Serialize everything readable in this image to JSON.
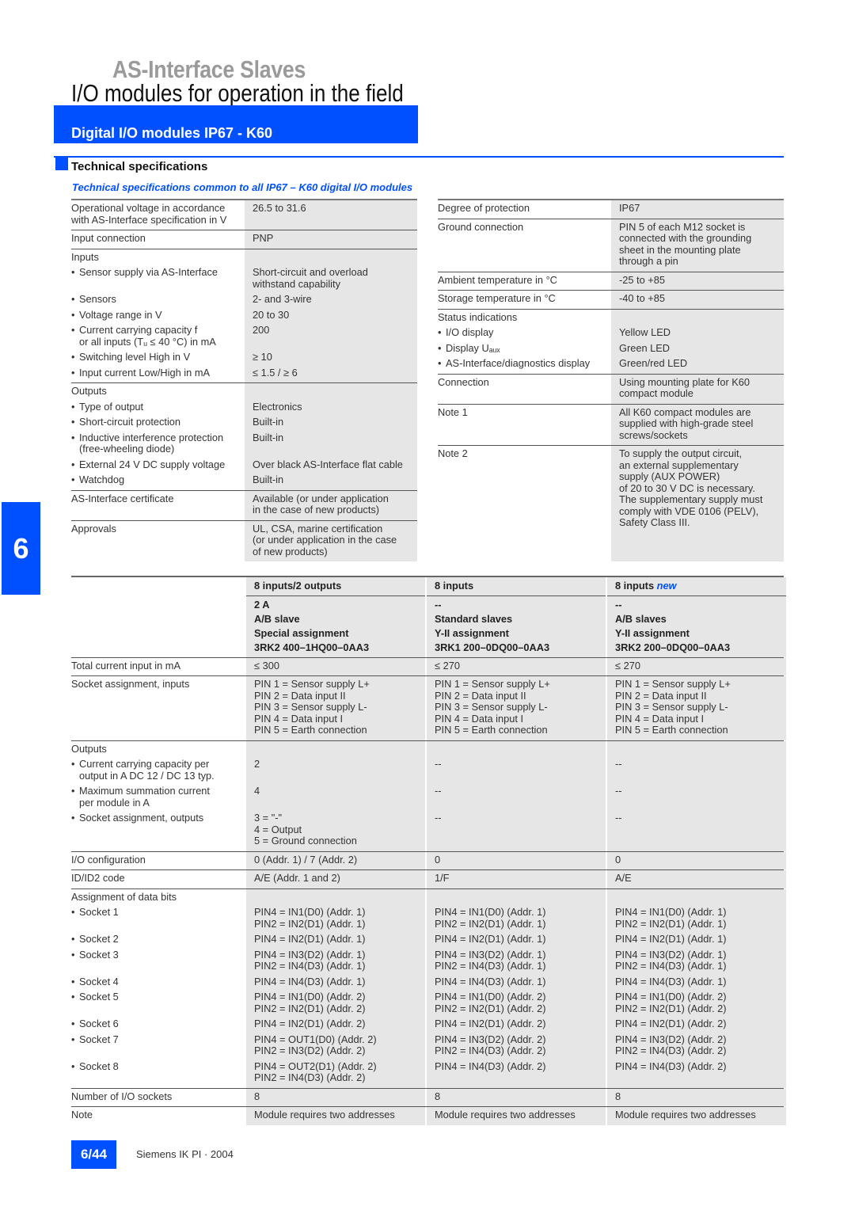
{
  "header": {
    "supertitle": "AS-Interface Slaves",
    "title": "I/O modules for operation in the field",
    "banner": "Digital I/O modules IP67 - K60",
    "section_title": "Technical specifications",
    "subtitle": "Technical specifications common to all IP67 – K60 digital I/O modules"
  },
  "side_tab": "6",
  "footer": {
    "page": "6/44",
    "text": "Siemens IK PI · 2004"
  },
  "colors": {
    "accent": "#0050ff",
    "cell_gray": "#e6e6e6"
  },
  "top_left": {
    "rows": [
      {
        "items": [
          {
            "label": "Operational voltage in accordance\nwith AS-Interface specification in V",
            "values": [
              "26.5 to 31.6"
            ]
          }
        ]
      },
      {
        "items": [
          {
            "label": "Input connection",
            "values": [
              "PNP"
            ]
          }
        ]
      },
      {
        "items": [
          {
            "label": "Inputs",
            "values": [
              ""
            ]
          },
          {
            "label": "Sensor supply via AS-Interface",
            "bullet": true,
            "values": [
              "Short-circuit and overload\nwithstand capability"
            ]
          },
          {
            "label": "Sensors",
            "bullet": true,
            "values": [
              "2- and 3-wire"
            ]
          },
          {
            "label": "Voltage range in V",
            "bullet": true,
            "values": [
              "20 to 30"
            ]
          },
          {
            "label": "Current carrying capacity f\nor all inputs (Tᵤ ≤ 40 °C) in mA",
            "bullet": true,
            "values": [
              "200"
            ]
          },
          {
            "label": "Switching level High in V",
            "bullet": true,
            "values": [
              "≥ 10"
            ]
          },
          {
            "label": "Input current Low/High in mA",
            "bullet": true,
            "values": [
              "≤ 1.5 / ≥ 6"
            ]
          }
        ]
      },
      {
        "items": [
          {
            "label": "Outputs",
            "values": [
              ""
            ]
          },
          {
            "label": "Type of output",
            "bullet": true,
            "values": [
              "Electronics"
            ]
          },
          {
            "label": "Short-circuit protection",
            "bullet": true,
            "values": [
              "Built-in"
            ]
          },
          {
            "label": "Inductive interference protection\n(free-wheeling diode)",
            "bullet": true,
            "values": [
              "Built-in"
            ]
          },
          {
            "label": "External 24 V DC supply voltage",
            "bullet": true,
            "values": [
              "Over black AS-Interface flat cable"
            ]
          },
          {
            "label": "Watchdog",
            "bullet": true,
            "values": [
              "Built-in"
            ]
          }
        ]
      },
      {
        "items": [
          {
            "label": "AS-Interface certificate",
            "values": [
              "Available (or under application\nin the case of new products)"
            ]
          }
        ]
      },
      {
        "items": [
          {
            "label": "Approvals",
            "values": [
              "UL, CSA, marine certification\n(or under application in the case\nof new products)"
            ]
          }
        ]
      }
    ]
  },
  "top_right": {
    "rows": [
      {
        "items": [
          {
            "label": "Degree of protection",
            "values": [
              "IP67"
            ]
          }
        ]
      },
      {
        "items": [
          {
            "label": "Ground connection",
            "values": [
              "PIN 5 of each M12 socket is\nconnected with the grounding\nsheet in the mounting plate\nthrough a pin"
            ]
          }
        ]
      },
      {
        "items": [
          {
            "label": "Ambient temperature in °C",
            "values": [
              "-25 to +85"
            ]
          }
        ]
      },
      {
        "items": [
          {
            "label": "Storage temperature in °C",
            "values": [
              "-40 to +85"
            ]
          }
        ]
      },
      {
        "items": [
          {
            "label": "Status indications",
            "values": [
              ""
            ]
          },
          {
            "label": "I/O display",
            "bullet": true,
            "values": [
              "Yellow LED"
            ]
          },
          {
            "label": "Display Uₐᵤₓ",
            "bullet": true,
            "values": [
              "Green LED"
            ]
          },
          {
            "label": "AS-Interface/diagnostics display",
            "bullet": true,
            "values": [
              "Green/red LED"
            ]
          }
        ]
      },
      {
        "items": [
          {
            "label": "Connection",
            "values": [
              "Using mounting plate for K60\ncompact module"
            ]
          }
        ]
      },
      {
        "items": [
          {
            "label": "Note 1",
            "values": [
              "All K60 compact modules are\nsupplied with high-grade steel\nscrews/sockets"
            ]
          }
        ]
      },
      {
        "items": [
          {
            "label": "Note 2",
            "values": [
              "To supply the output circuit,\nan external supplementary\nsupply (AUX POWER)\nof 20 to 30 V DC is necessary.\nThe supplementary supply must\ncomply with VDE 0106 (PELV),\nSafety Class III."
            ]
          }
        ]
      }
    ]
  },
  "bottom": {
    "columns": [
      {
        "title": "8 inputs/2 outputs",
        "tag": "",
        "details": "2 A\nA/B slave\nSpecial assignment\n3RK2 400–1HQ00–0AA3"
      },
      {
        "title": "8 inputs",
        "tag": "",
        "details": "--\nStandard slaves\nY-II assignment\n3RK1 200–0DQ00–0AA3"
      },
      {
        "title": "8 inputs",
        "tag": "new",
        "details": "--\nA/B slaves\nY-II assignment\n3RK2 200–0DQ00–0AA3"
      }
    ],
    "rows": [
      {
        "items": [
          {
            "label": "Total current input in mA",
            "values": [
              "≤ 300",
              "≤ 270",
              "≤ 270"
            ]
          }
        ]
      },
      {
        "items": [
          {
            "label": "Socket assignment, inputs",
            "values": [
              "PIN 1 = Sensor supply L+\nPIN 2 = Data input II\nPIN 3 = Sensor supply L-\nPIN 4 = Data input I\nPIN 5 = Earth connection",
              "PIN 1 = Sensor supply L+\nPIN 2 = Data input II\nPIN 3 = Sensor supply L-\nPIN 4 = Data input I\nPIN 5 = Earth connection",
              "PIN 1 = Sensor supply L+\nPIN 2 = Data input II\nPIN 3 = Sensor supply L-\nPIN 4 = Data input I\nPIN 5 = Earth connection"
            ]
          }
        ]
      },
      {
        "items": [
          {
            "label": "Outputs",
            "values": [
              "",
              "",
              ""
            ]
          },
          {
            "label": "Current carrying capacity per\noutput in A DC 12 / DC 13 typ.",
            "bullet": true,
            "values": [
              "2",
              "--",
              "--"
            ]
          },
          {
            "label": "Maximum summation current\nper module in A",
            "bullet": true,
            "values": [
              "4",
              "--",
              "--"
            ]
          },
          {
            "label": "Socket assignment, outputs",
            "bullet": true,
            "values": [
              "3 = \"-\"\n4 = Output\n5 = Ground connection",
              "--",
              "--"
            ]
          }
        ]
      },
      {
        "items": [
          {
            "label": "I/O configuration",
            "values": [
              "0 (Addr. 1) / 7 (Addr. 2)",
              "0",
              "0"
            ]
          }
        ]
      },
      {
        "items": [
          {
            "label": "ID/ID2 code",
            "values": [
              "A/E (Addr. 1 and 2)",
              "1/F",
              "A/E"
            ]
          }
        ]
      },
      {
        "items": [
          {
            "label": "Assignment of data bits",
            "values": [
              "",
              "",
              ""
            ]
          },
          {
            "label": "Socket 1",
            "bullet": true,
            "values": [
              "PIN4 = IN1(D0) (Addr. 1)\nPIN2 = IN2(D1) (Addr. 1)",
              "PIN4 = IN1(D0) (Addr. 1)\nPIN2 = IN2(D1) (Addr. 1)",
              "PIN4 = IN1(D0) (Addr. 1)\nPIN2 = IN2(D1) (Addr. 1)"
            ]
          },
          {
            "label": "Socket 2",
            "bullet": true,
            "values": [
              "PIN4 = IN2(D1) (Addr. 1)",
              "PIN4 = IN2(D1) (Addr. 1)",
              "PIN4 = IN2(D1) (Addr. 1)"
            ]
          },
          {
            "label": "Socket 3",
            "bullet": true,
            "values": [
              "PIN4 = IN3(D2) (Addr. 1)\nPIN2 = IN4(D3) (Addr. 1)",
              "PIN4 = IN3(D2) (Addr. 1)\nPIN2 = IN4(D3) (Addr. 1)",
              "PIN4 = IN3(D2) (Addr. 1)\nPIN2 = IN4(D3) (Addr. 1)"
            ]
          },
          {
            "label": "Socket 4",
            "bullet": true,
            "values": [
              "PIN4 = IN4(D3) (Addr. 1)",
              "PIN4 = IN4(D3) (Addr. 1)",
              "PIN4 = IN4(D3) (Addr. 1)"
            ]
          },
          {
            "label": "Socket 5",
            "bullet": true,
            "values": [
              "PIN4 = IN1(D0) (Addr. 2)\nPIN2 = IN2(D1) (Addr. 2)",
              "PIN4 = IN1(D0) (Addr. 2)\nPIN2 = IN2(D1) (Addr. 2)",
              "PIN4 = IN1(D0) (Addr. 2)\nPIN2 = IN2(D1) (Addr. 2)"
            ]
          },
          {
            "label": "Socket 6",
            "bullet": true,
            "values": [
              "PIN4 = IN2(D1) (Addr. 2)",
              "PIN4 = IN2(D1) (Addr. 2)",
              "PIN4 = IN2(D1) (Addr. 2)"
            ]
          },
          {
            "label": "Socket 7",
            "bullet": true,
            "values": [
              "PIN4 = OUT1(D0) (Addr. 2)\nPIN2 = IN3(D2) (Addr. 2)",
              "PIN4 = IN3(D2) (Addr. 2)\nPIN2 = IN4(D3) (Addr. 2)",
              "PIN4 = IN3(D2) (Addr. 2)\nPIN2 = IN4(D3) (Addr. 2)"
            ]
          },
          {
            "label": "Socket 8",
            "bullet": true,
            "values": [
              "PIN4 = OUT2(D1) (Addr. 2)\nPIN2 = IN4(D3) (Addr. 2)",
              "PIN4 = IN4(D3) (Addr. 2)",
              "PIN4 = IN4(D3) (Addr. 2)"
            ]
          }
        ]
      },
      {
        "items": [
          {
            "label": "Number of I/O sockets",
            "values": [
              "8",
              "8",
              "8"
            ]
          }
        ]
      },
      {
        "items": [
          {
            "label": "Note",
            "values": [
              "Module requires two addresses",
              "Module requires two addresses",
              "Module requires two addresses"
            ]
          }
        ]
      }
    ]
  }
}
